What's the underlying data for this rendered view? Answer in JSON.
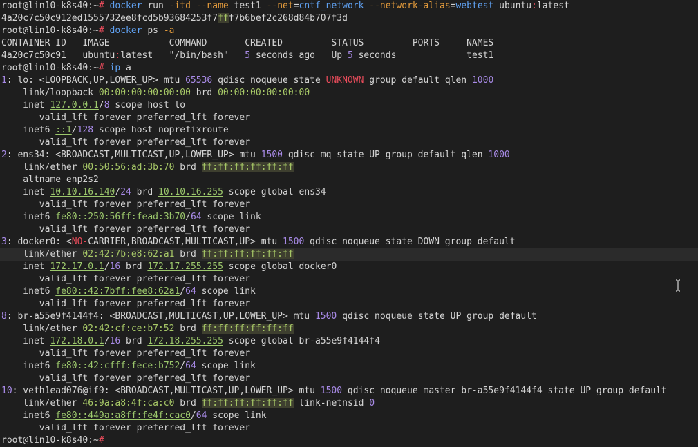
{
  "terminal": {
    "prompt_user": "root@lin10-k8s40",
    "prompt_path": ":~",
    "prompt_symbol": "#",
    "lines": [
      {
        "type": "cmd",
        "parts": [
          [
            "docker",
            "cmd"
          ],
          [
            " run ",
            "t"
          ],
          [
            "-itd",
            "flag"
          ],
          [
            " ",
            "t"
          ],
          [
            "--name",
            "flag"
          ],
          [
            " test1 ",
            "t"
          ],
          [
            "--net",
            "flag"
          ],
          [
            "=",
            "t"
          ],
          [
            "cntf_network",
            "val"
          ],
          [
            " ",
            "t"
          ],
          [
            "--network-alias",
            "flag"
          ],
          [
            "=",
            "t"
          ],
          [
            "webtest",
            "val"
          ],
          [
            " ubuntu",
            "t"
          ],
          [
            ":",
            "sym"
          ],
          [
            "latest",
            "t"
          ]
        ]
      },
      {
        "type": "out",
        "parts": [
          [
            "4a20c7c50c912ed1555732ee8fcd5b93684253f7",
            "t"
          ],
          [
            "ff",
            "hexhl"
          ],
          [
            "f7b6bef2c268d84b707f3d",
            "t"
          ]
        ]
      },
      {
        "type": "cmd",
        "parts": [
          [
            "docker",
            "cmd"
          ],
          [
            " ps ",
            "t"
          ],
          [
            "-a",
            "flag"
          ]
        ]
      },
      {
        "type": "out",
        "parts": [
          [
            "CONTAINER ID   IMAGE           COMMAND       CREATED         STATUS         PORTS     NAMES",
            "t"
          ]
        ]
      },
      {
        "type": "out",
        "parts": [
          [
            "4a20c7c50c91   ubuntu",
            "t"
          ],
          [
            ":",
            "sym"
          ],
          [
            "latest   ",
            "t"
          ],
          [
            "\"/bin/bash\"",
            "t"
          ],
          [
            "   ",
            "t"
          ],
          [
            "5",
            "num"
          ],
          [
            " seconds ago   Up ",
            "t"
          ],
          [
            "5",
            "num"
          ],
          [
            " seconds             test1",
            "t"
          ]
        ]
      },
      {
        "type": "cmd",
        "parts": [
          [
            "ip",
            "cmd"
          ],
          [
            " a",
            "t"
          ]
        ]
      },
      {
        "type": "out",
        "parts": [
          [
            "1",
            "num"
          ],
          [
            ": lo: <LOOPBACK,UP,LOWER_UP> mtu ",
            "t"
          ],
          [
            "65536",
            "num"
          ],
          [
            " qdisc noqueue state ",
            "t"
          ],
          [
            "UNKNOWN",
            "warn"
          ],
          [
            " group default qlen ",
            "t"
          ],
          [
            "1000",
            "num"
          ]
        ]
      },
      {
        "type": "out",
        "parts": [
          [
            "    link/loopback ",
            "t"
          ],
          [
            "00:00:00:00:00:00",
            "mac-ok"
          ],
          [
            " brd ",
            "t"
          ],
          [
            "00:00:00:00:00:00",
            "mac-ok"
          ]
        ]
      },
      {
        "type": "out",
        "parts": [
          [
            "    inet ",
            "t"
          ],
          [
            "127.0.0.1",
            "ip"
          ],
          [
            "/",
            "t"
          ],
          [
            "8",
            "num"
          ],
          [
            " scope host lo",
            "t"
          ]
        ]
      },
      {
        "type": "out",
        "parts": [
          [
            "       valid_lft forever preferred_lft forever",
            "t"
          ]
        ]
      },
      {
        "type": "out",
        "parts": [
          [
            "    inet6 ",
            "t"
          ],
          [
            "::1",
            "ip"
          ],
          [
            "/",
            "t"
          ],
          [
            "128",
            "num"
          ],
          [
            " scope host noprefixroute",
            "t"
          ]
        ]
      },
      {
        "type": "out",
        "parts": [
          [
            "       valid_lft forever preferred_lft forever",
            "t"
          ]
        ]
      },
      {
        "type": "out",
        "parts": [
          [
            "2",
            "num"
          ],
          [
            ": ens34: <BROADCAST,MULTICAST,UP,LOWER_UP> mtu ",
            "t"
          ],
          [
            "1500",
            "num"
          ],
          [
            " qdisc mq state UP group default qlen ",
            "t"
          ],
          [
            "1000",
            "num"
          ]
        ]
      },
      {
        "type": "out",
        "parts": [
          [
            "    link/ether ",
            "t"
          ],
          [
            "00:50:56:ad:3b:70",
            "mac-ok"
          ],
          [
            " brd ",
            "t"
          ],
          [
            "ff:ff:ff:ff:ff:ff",
            "hexhl"
          ]
        ]
      },
      {
        "type": "out",
        "parts": [
          [
            "    altname enp2s2",
            "t"
          ]
        ]
      },
      {
        "type": "out",
        "parts": [
          [
            "    inet ",
            "t"
          ],
          [
            "10.10.16.140",
            "ip"
          ],
          [
            "/",
            "t"
          ],
          [
            "24",
            "num"
          ],
          [
            " brd ",
            "t"
          ],
          [
            "10.10.16.255",
            "ip"
          ],
          [
            " scope global ens34",
            "t"
          ]
        ]
      },
      {
        "type": "out",
        "parts": [
          [
            "       valid_lft forever preferred_lft forever",
            "t"
          ]
        ]
      },
      {
        "type": "out",
        "parts": [
          [
            "    inet6 ",
            "t"
          ],
          [
            "fe80::250:56ff:fead:3b70",
            "ip"
          ],
          [
            "/",
            "t"
          ],
          [
            "64",
            "num"
          ],
          [
            " scope link",
            "t"
          ]
        ]
      },
      {
        "type": "out",
        "parts": [
          [
            "       valid_lft forever preferred_lft forever",
            "t"
          ]
        ]
      },
      {
        "type": "out",
        "parts": [
          [
            "3",
            "num"
          ],
          [
            ": docker0: <",
            "t"
          ],
          [
            "NO-",
            "warn"
          ],
          [
            "CARRIER,BROADCAST,MULTICAST,UP> mtu ",
            "t"
          ],
          [
            "1500",
            "num"
          ],
          [
            " qdisc noqueue state DOWN group default",
            "t"
          ]
        ]
      },
      {
        "type": "out",
        "hl": true,
        "parts": [
          [
            "    link/ether ",
            "t"
          ],
          [
            "02:42:7b:e8:62:a1",
            "mac-ok"
          ],
          [
            " brd ",
            "t"
          ],
          [
            "ff:ff:ff:ff:ff:ff",
            "hexhl"
          ]
        ]
      },
      {
        "type": "out",
        "parts": [
          [
            "    inet ",
            "t"
          ],
          [
            "172.17.0.1",
            "ip"
          ],
          [
            "/",
            "t"
          ],
          [
            "16",
            "num"
          ],
          [
            " brd ",
            "t"
          ],
          [
            "172.17.255.255",
            "ip"
          ],
          [
            " scope global docker0",
            "t"
          ]
        ]
      },
      {
        "type": "out",
        "parts": [
          [
            "       valid_lft forever preferred_lft forever",
            "t"
          ]
        ]
      },
      {
        "type": "out",
        "parts": [
          [
            "    inet6 ",
            "t"
          ],
          [
            "fe80::42:7bff:fee8:62a1",
            "ip"
          ],
          [
            "/",
            "t"
          ],
          [
            "64",
            "num"
          ],
          [
            " scope link",
            "t"
          ]
        ]
      },
      {
        "type": "out",
        "parts": [
          [
            "       valid_lft forever preferred_lft forever",
            "t"
          ]
        ]
      },
      {
        "type": "out",
        "parts": [
          [
            "8",
            "num"
          ],
          [
            ": br-a55e9f4144f4: <BROADCAST,MULTICAST,UP,LOWER_UP> mtu ",
            "t"
          ],
          [
            "1500",
            "num"
          ],
          [
            " qdisc noqueue state UP group default",
            "t"
          ]
        ]
      },
      {
        "type": "out",
        "parts": [
          [
            "    link/ether ",
            "t"
          ],
          [
            "02:42:cf:ce:b7:52",
            "mac-ok"
          ],
          [
            " brd ",
            "t"
          ],
          [
            "ff:ff:ff:ff:ff:ff",
            "hexhl"
          ]
        ]
      },
      {
        "type": "out",
        "parts": [
          [
            "    inet ",
            "t"
          ],
          [
            "172.18.0.1",
            "ip"
          ],
          [
            "/",
            "t"
          ],
          [
            "16",
            "num"
          ],
          [
            " brd ",
            "t"
          ],
          [
            "172.18.255.255",
            "ip"
          ],
          [
            " scope global br-a55e9f4144f4",
            "t"
          ]
        ]
      },
      {
        "type": "out",
        "parts": [
          [
            "       valid_lft forever preferred_lft forever",
            "t"
          ]
        ]
      },
      {
        "type": "out",
        "parts": [
          [
            "    inet6 ",
            "t"
          ],
          [
            "fe80::42:cfff:fece:b752",
            "ip"
          ],
          [
            "/",
            "t"
          ],
          [
            "64",
            "num"
          ],
          [
            " scope link",
            "t"
          ]
        ]
      },
      {
        "type": "out",
        "parts": [
          [
            "       valid_lft forever preferred_lft forever",
            "t"
          ]
        ]
      },
      {
        "type": "out",
        "parts": [
          [
            "10",
            "num"
          ],
          [
            ": veth1ead076@if9: <BROADCAST,MULTICAST,UP,LOWER_UP> mtu ",
            "t"
          ],
          [
            "1500",
            "num"
          ],
          [
            " qdisc noqueue master br-a55e9f4144f4 state UP group default",
            "t"
          ]
        ]
      },
      {
        "type": "out",
        "parts": [
          [
            "    link/ether ",
            "t"
          ],
          [
            "46:9a:a8:4f:ca:c0",
            "mac-ok"
          ],
          [
            " brd ",
            "t"
          ],
          [
            "ff:ff:ff:ff:ff:ff",
            "hexhl"
          ],
          [
            " link-netnsid ",
            "t"
          ],
          [
            "0",
            "num"
          ]
        ]
      },
      {
        "type": "out",
        "parts": [
          [
            "    inet6 ",
            "t"
          ],
          [
            "fe80::449a:a8ff:fe4f:cac0",
            "ip"
          ],
          [
            "/",
            "t"
          ],
          [
            "64",
            "num"
          ],
          [
            " scope link",
            "t"
          ]
        ]
      },
      {
        "type": "out",
        "parts": [
          [
            "       valid_lft forever preferred_lft forever",
            "t"
          ]
        ]
      },
      {
        "type": "prompt",
        "parts": []
      }
    ]
  },
  "colors": {
    "background": "#1e1e1e",
    "foreground": "#d4d4d4",
    "command": "#5fa0f0",
    "flag": "#e29a3c",
    "number": "#a98be8",
    "warning": "#e64b5a",
    "ip": "#9cc86c"
  },
  "icons": {
    "text_cursor": "i-beam-cursor-icon"
  }
}
